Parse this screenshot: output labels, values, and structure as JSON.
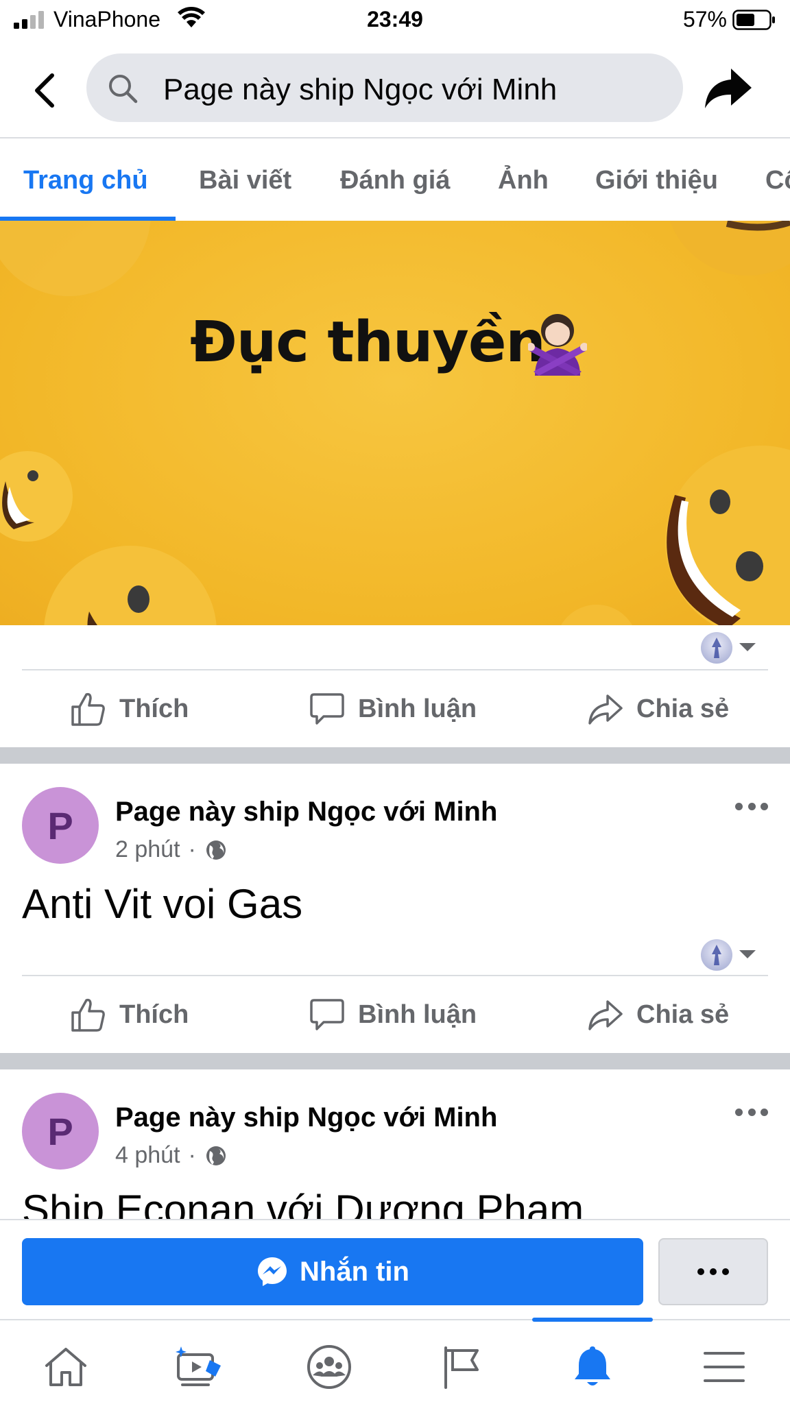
{
  "status_bar": {
    "carrier": "VinaPhone",
    "time": "23:49",
    "battery": "57%"
  },
  "search": {
    "query": "Page này ship Ngọc với Minh"
  },
  "tabs": [
    {
      "label": "Trang chủ",
      "active": true
    },
    {
      "label": "Bài viết"
    },
    {
      "label": "Đánh giá"
    },
    {
      "label": "Ảnh"
    },
    {
      "label": "Giới thiệu"
    },
    {
      "label": "Cộ"
    }
  ],
  "cover": {
    "title": "Đục thuyền",
    "emoji": "person-gesturing-no"
  },
  "actions": {
    "like": "Thích",
    "comment": "Bình luận",
    "share": "Chia sẻ"
  },
  "posts": [
    {
      "avatar_letter": "P",
      "author": "Page này ship Ngọc với Minh",
      "time": "2 phút",
      "separator": "·",
      "text": "Anti Vit voi Gas"
    },
    {
      "avatar_letter": "P",
      "author": "Page này ship Ngọc với Minh",
      "time": "4 phút",
      "separator": "·",
      "text": "Ship Econan với Dương Phạm"
    }
  ],
  "bottom": {
    "message_label": "Nhắn tin"
  },
  "colors": {
    "accent": "#1877f2",
    "cover_bg": "#f2b728",
    "avatar_bg": "#c993d7",
    "text_secondary": "#65676b"
  }
}
